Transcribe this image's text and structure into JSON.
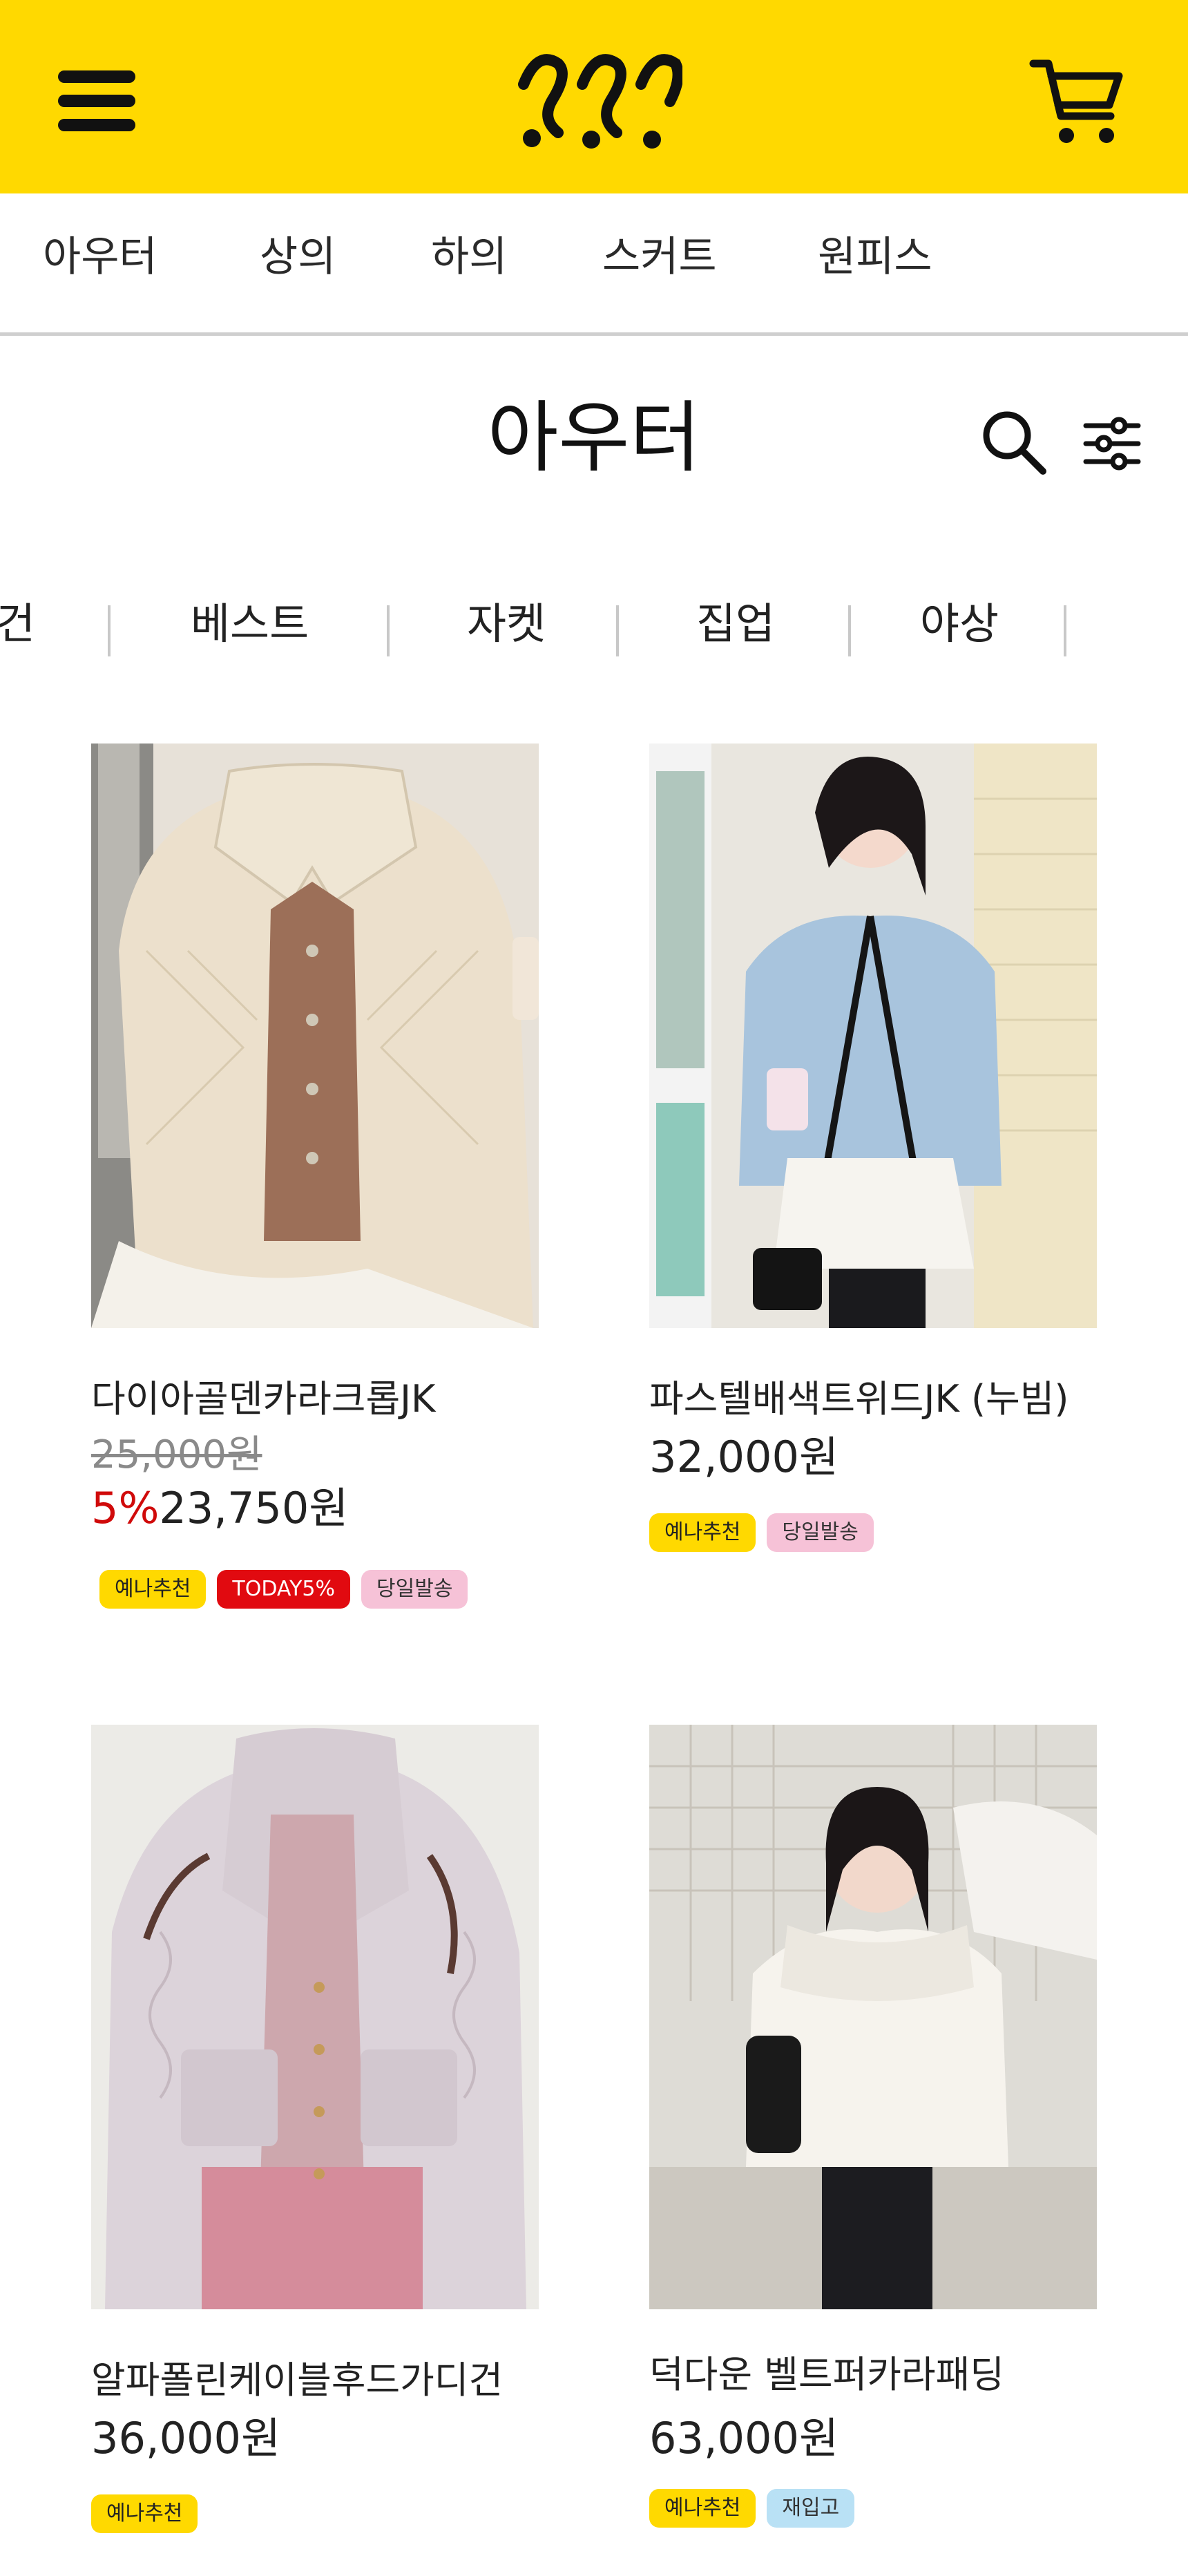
{
  "header": {
    "menu_icon": "hamburger-menu-icon",
    "logo_icon": "brand-logo-icon",
    "cart_icon": "shopping-cart-icon",
    "brand_color": "#ffd900"
  },
  "category_nav": {
    "items": [
      "아우터",
      "상의",
      "하의",
      "스커트",
      "원피스"
    ]
  },
  "page": {
    "title": "아우터",
    "search_icon": "search-icon",
    "filter_icon": "filter-sliders-icon"
  },
  "subcategories": {
    "items": [
      "건",
      "베스트",
      "자켓",
      "집업",
      "야상"
    ]
  },
  "products": [
    {
      "name": "다이아골덴카라크롭JK",
      "original_price": "25,000원",
      "discount": "5%",
      "price": "23,750원",
      "badges": [
        "예나추천",
        "TODAY5%",
        "당일발송"
      ]
    },
    {
      "name": "파스텔배색트위드JK (누빔)",
      "price": "32,000원",
      "badges": [
        "예나추천",
        "당일발송"
      ]
    },
    {
      "name": "알파폴린케이블후드가디건",
      "price": "36,000원",
      "badges": [
        "예나추천"
      ]
    },
    {
      "name": "덕다운 벨트퍼카라패딩",
      "price": "63,000원",
      "badges": [
        "예나추천",
        "재입고"
      ]
    }
  ]
}
